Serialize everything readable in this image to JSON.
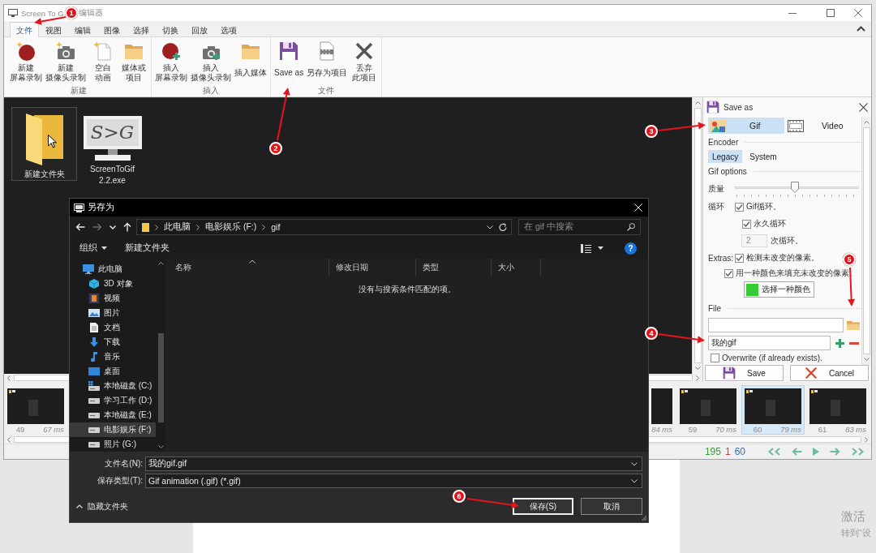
{
  "editor": {
    "title_segments": [
      "Screen To G",
      "编辑器"
    ],
    "tabs": [
      {
        "label": "文件",
        "selected": true
      },
      {
        "label": "视图",
        "selected": false
      },
      {
        "label": "编辑",
        "selected": false
      },
      {
        "label": "图像",
        "selected": false
      },
      {
        "label": "选择",
        "selected": false
      },
      {
        "label": "切换",
        "selected": false
      },
      {
        "label": "回放",
        "selected": false
      },
      {
        "label": "选项",
        "selected": false
      }
    ],
    "ribbon_groups": [
      {
        "label": "新建",
        "commands": [
          {
            "lines": [
              "新建",
              "屏幕录制"
            ],
            "kind": "newrecording"
          },
          {
            "lines": [
              "新建",
              "摄像头录制"
            ],
            "kind": "newwebcam"
          },
          {
            "lines": [
              "空白",
              "动画"
            ],
            "kind": "blank"
          },
          {
            "lines": [
              "媒体或",
              "项目"
            ],
            "kind": "media"
          }
        ]
      },
      {
        "label": "插入",
        "commands": [
          {
            "lines": [
              "插入",
              "屏幕录制"
            ],
            "kind": "insertrecording"
          },
          {
            "lines": [
              "插入",
              "摄像头录制"
            ],
            "kind": "insertwebcam"
          },
          {
            "lines": [
              "插入媒体"
            ],
            "kind": "media"
          }
        ]
      },
      {
        "label": "文件",
        "commands": [
          {
            "lines": [
              "Save as"
            ],
            "kind": "saveas"
          },
          {
            "lines": [
              "另存为项目"
            ],
            "kind": "saveproject"
          },
          {
            "lines": [
              "丢弃",
              "此项目"
            ],
            "kind": "discard"
          }
        ]
      }
    ],
    "canvas": {
      "items": [
        {
          "label": "新建文件夹",
          "kind": "folder",
          "selected": true
        },
        {
          "label": "ScreenToGif 2.2.exe",
          "kind": "app",
          "logo_text": "S>G",
          "selected": false
        }
      ]
    },
    "save_panel": {
      "title": "Save as",
      "formats": [
        {
          "label": "Gif",
          "kind": "gif",
          "selected": true
        },
        {
          "label": "Video",
          "kind": "video",
          "selected": false
        }
      ],
      "encoder": {
        "heading": "Encoder",
        "options": [
          {
            "label": "Legacy",
            "selected": true
          },
          {
            "label": "System",
            "selected": false
          }
        ]
      },
      "gif_options": {
        "heading": "Gif options",
        "quality_label": "质量",
        "quality": {
          "level": 0.48
        },
        "loop_label": "循环",
        "loop": {
          "label": "Gif循环。",
          "checked": true
        },
        "forever": {
          "label": "永久循环",
          "checked": true
        },
        "repeat": {
          "value": "2",
          "disabled": true,
          "label": "次循环。"
        },
        "extras_label": "Extras:",
        "detect": {
          "label": "检测未改变的像素。",
          "checked": true
        },
        "fill": {
          "label": "用一种颜色来填充未改变的像素。",
          "checked": true
        },
        "color_button": {
          "label": "选择一种颜色",
          "color": "#33cc33"
        }
      },
      "file": {
        "heading": "File",
        "filename": "我的gif",
        "overwrite": {
          "label": "Overwrite (if already exists).",
          "checked": false
        }
      },
      "buttons": [
        {
          "label": "Save",
          "kind": "save"
        },
        {
          "label": "Cancel",
          "kind": "cancel"
        }
      ]
    },
    "timeline": {
      "frames": [
        {
          "number": "49",
          "time": "67 ms",
          "selected": false
        },
        {
          "time": "84 ms",
          "selected": false
        },
        {
          "number": "59",
          "time": "70 ms",
          "selected": false
        },
        {
          "number": "60",
          "time": "79 ms",
          "selected": true
        },
        {
          "number": "61",
          "time": "83 ms",
          "selected": false
        }
      ]
    },
    "status": {
      "frame_count": "195",
      "selected_count": "1",
      "current_frame": "60"
    }
  },
  "save_dialog": {
    "title": "另存为",
    "nav_buttons": [
      {
        "kind": "back",
        "disabled": false
      },
      {
        "kind": "forward",
        "disabled": true
      },
      {
        "kind": "recent",
        "disabled": false
      },
      {
        "kind": "up",
        "disabled": false
      }
    ],
    "path": [
      "此电脑",
      "电影娱乐 (F:)",
      "gif"
    ],
    "search": {
      "placeholder": "在 gif 中搜索"
    },
    "toolbar": {
      "organize": "组织",
      "new_folder": "新建文件夹",
      "help": "?"
    },
    "nav_tree": [
      {
        "label": "此电脑",
        "kind": "pc",
        "selected": false,
        "children": [
          {
            "label": "3D 对象",
            "kind": "objects",
            "selected": false
          },
          {
            "label": "视频",
            "kind": "videos",
            "selected": false
          },
          {
            "label": "图片",
            "kind": "pictures",
            "selected": false
          },
          {
            "label": "文档",
            "kind": "documents",
            "selected": false
          },
          {
            "label": "下载",
            "kind": "downloads",
            "selected": false
          },
          {
            "label": "音乐",
            "kind": "music",
            "selected": false
          },
          {
            "label": "桌面",
            "kind": "desktop",
            "selected": false
          },
          {
            "label": "本地磁盘 (C:)",
            "kind": "systemdrive",
            "selected": false
          },
          {
            "label": "学习工作 (D:)",
            "kind": "drive",
            "selected": false
          },
          {
            "label": "本地磁盘 (E:)",
            "kind": "drive",
            "selected": false
          },
          {
            "label": "电影娱乐 (F:)",
            "kind": "drive",
            "selected": true
          },
          {
            "label": "照片 (G:)",
            "kind": "drive",
            "selected": false
          }
        ]
      }
    ],
    "columns": [
      {
        "label": "名称",
        "sorted": true
      },
      {
        "label": "修改日期",
        "sorted": false
      },
      {
        "label": "类型",
        "sorted": false
      },
      {
        "label": "大小",
        "sorted": false
      }
    ],
    "empty_message": "没有与搜索条件匹配的项。",
    "filename": {
      "label": "文件名(N):",
      "value": "我的gif.gif"
    },
    "filetype": {
      "label": "保存类型(T):",
      "value": "Gif animation (.gif) (*.gif)"
    },
    "hide_folders": "隐藏文件夹",
    "buttons": [
      {
        "label": "保存(S)",
        "focused": true
      },
      {
        "label": "取消",
        "focused": false
      }
    ]
  },
  "annotations": [
    {
      "number": "1"
    },
    {
      "number": "2"
    },
    {
      "number": "3"
    },
    {
      "number": "4"
    },
    {
      "number": "5"
    },
    {
      "number": "6"
    }
  ],
  "activation_notice": {
    "title": "激活",
    "subtitle": "转到“设"
  }
}
